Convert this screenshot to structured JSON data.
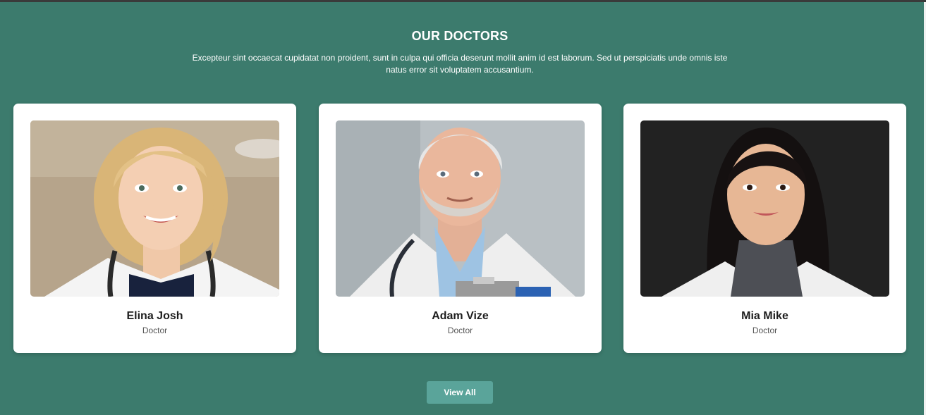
{
  "section": {
    "title": "OUR DOCTORS",
    "description": "Excepteur sint occaecat cupidatat non proident, sunt in culpa qui officia deserunt mollit anim id est laborum. Sed ut perspiciatis unde omnis iste natus error sit voluptatem accusantium."
  },
  "doctors": [
    {
      "name": "Elina Josh",
      "role": "Doctor"
    },
    {
      "name": "Adam Vize",
      "role": "Doctor"
    },
    {
      "name": "Mia Mike",
      "role": "Doctor"
    }
  ],
  "view_all_label": "View All",
  "colors": {
    "background": "#3c7b6d",
    "card": "#ffffff",
    "button": "#5aa49a"
  }
}
